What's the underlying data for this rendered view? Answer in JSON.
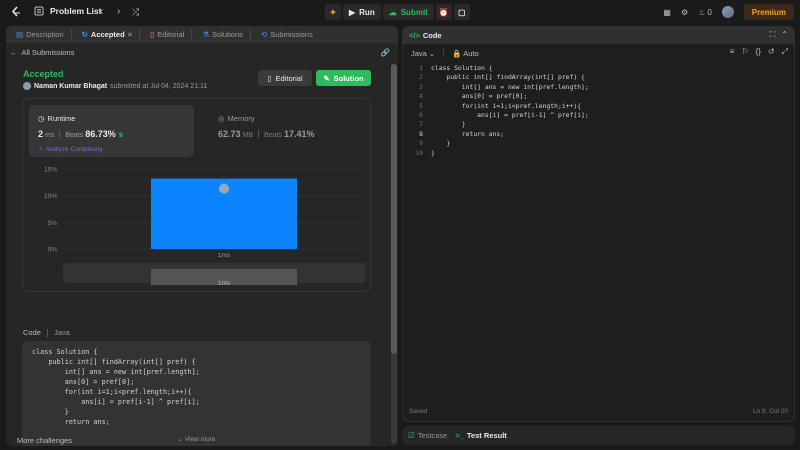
{
  "nav": {
    "title": "Problem List",
    "run_label": "Run",
    "submit_label": "Submit",
    "streak_count": "0",
    "premium_label": "Premium"
  },
  "left": {
    "tabs": [
      {
        "label": "Description"
      },
      {
        "label": "Accepted"
      },
      {
        "label": "Editorial"
      },
      {
        "label": "Solutions"
      },
      {
        "label": "Submissions"
      }
    ],
    "back_label": "All Submissions",
    "status": "Accepted",
    "author": "Naman Kumar Bhagat",
    "submitted_text": "submitted at Jul 04, 2024 21:11",
    "editorial_btn": "Editorial",
    "solution_btn": "Solution",
    "runtime": {
      "label": "Runtime",
      "value": "2",
      "unit": "ms",
      "beats_label": "Beats",
      "beats": "86.73%",
      "analyze": "Analyze Complexity"
    },
    "memory": {
      "label": "Memory",
      "value": "62.73",
      "unit": "MB",
      "beats_label": "Beats",
      "beats": "17.41%"
    },
    "code_label": "Code",
    "code_lang": "Java",
    "code_lines": [
      "class Solution {",
      "    public int[] findArray(int[] pref) {",
      "        int[] ans = new int[pref.length];",
      "        ans[0] = pref[0];",
      "        for(int i=1;i<pref.length;i++){",
      "            ans[i] = pref[i-1] ^ pref[i];",
      "        }",
      "        return ans;"
    ],
    "view_more": "View more",
    "more_challenges": "More challenges"
  },
  "chart_data": {
    "type": "bar",
    "categories": [
      "1ms"
    ],
    "values": [
      13.2
    ],
    "ylim": [
      0,
      15
    ],
    "yticks": [
      "0%",
      "5%",
      "10%",
      "15%"
    ],
    "bar_color": "#0a84ff",
    "distribution_label": "1ms"
  },
  "right": {
    "tab_label": "Code",
    "language": "Java",
    "mode": "Auto",
    "status_left": "Saved",
    "status_right": "Ln 8, Col 20",
    "line_numbers": [
      "1",
      "2",
      "3",
      "4",
      "5",
      "6",
      "7",
      "8",
      "9",
      "10"
    ]
  },
  "bottom": {
    "testcase": "Testcase",
    "test_result": "Test Result"
  },
  "colors": {
    "accent_green": "#2cbb5d",
    "premium": "#ffa116",
    "chart_bar": "#0a84ff"
  }
}
